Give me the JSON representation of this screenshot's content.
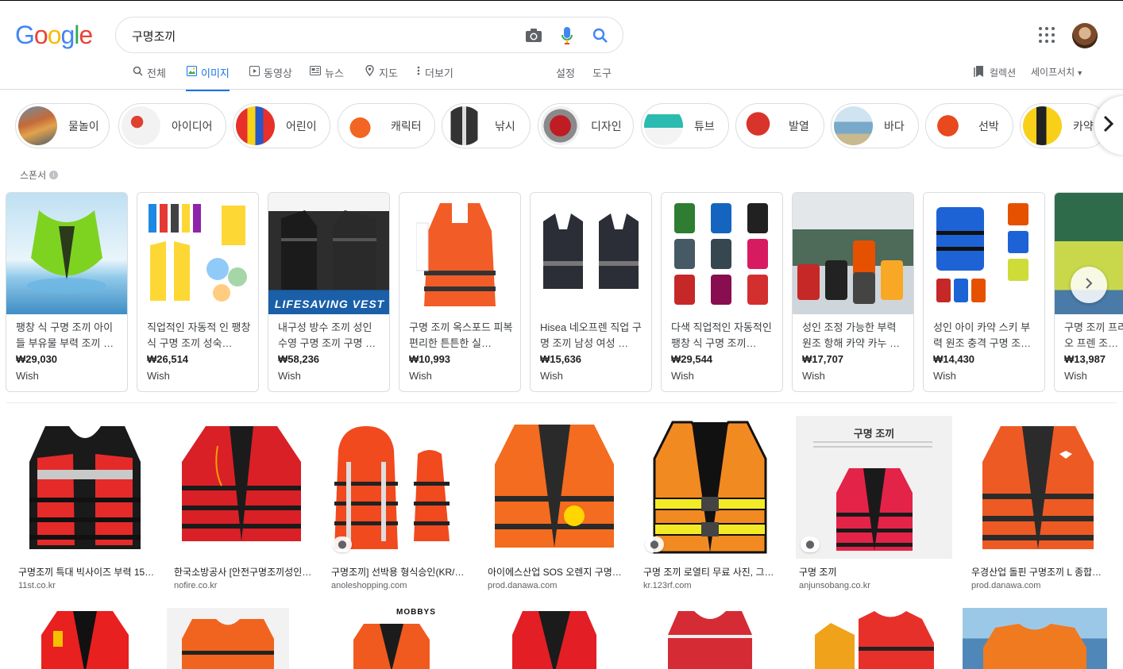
{
  "header": {
    "logo": "Google",
    "query": "구명조끼"
  },
  "tabs": [
    {
      "label": "전체",
      "icon": "search-icon"
    },
    {
      "label": "이미지",
      "icon": "image-icon",
      "active": true
    },
    {
      "label": "동영상",
      "icon": "video-icon"
    },
    {
      "label": "뉴스",
      "icon": "news-icon"
    },
    {
      "label": "지도",
      "icon": "map-pin-icon"
    },
    {
      "label": "더보기",
      "icon": "more-vert-icon"
    }
  ],
  "tools": {
    "settings": "설정",
    "tools": "도구",
    "collections": "컬렉션",
    "safesearch": "세이프서치"
  },
  "chips": [
    "물놀이",
    "아이디어",
    "어린이",
    "캐릭터",
    "낚시",
    "디자인",
    "튜브",
    "발열",
    "바다",
    "선박",
    "카약"
  ],
  "sponsored_label": "스폰서",
  "ads": [
    {
      "title": "팽창 식 구명 조끼 아이들 부유물 부력 조끼 …",
      "price": "₩29,030",
      "store": "Wish"
    },
    {
      "title": "직업적인 자동적 인 팽창 식 구명 조끼 성숙…",
      "price": "₩26,514",
      "store": "Wish"
    },
    {
      "title": "내구성 방수 조끼 성인 수영 구명 조끼 구명 …",
      "price": "₩58,236",
      "store": "Wish"
    },
    {
      "title": "구명 조끼 옥스포드 피복 편리한 튼튼한 실…",
      "price": "₩10,993",
      "store": "Wish"
    },
    {
      "title": "Hisea 네오프렌 직업 구명 조끼 남성 여성 …",
      "price": "₩15,636",
      "store": "Wish"
    },
    {
      "title": "다색 직업적인 자동적인 팽창 식 구명 조끼…",
      "price": "₩29,544",
      "store": "Wish"
    },
    {
      "title": "성인 조정 가능한 부력 원조 항해 카약 카누 …",
      "price": "₩17,707",
      "store": "Wish"
    },
    {
      "title": "성인 아이 카약 스키 부력 원조 충격 구명 조…",
      "price": "₩14,430",
      "store": "Wish"
    },
    {
      "title": "구명 조끼 프리오 프렌 조끼 …",
      "price": "₩13,987",
      "store": "Wish"
    }
  ],
  "results": [
    {
      "title": "구명조끼 특대 빅사이즈 부력 15…",
      "domain": "11st.co.kr"
    },
    {
      "title": "한국소방공사 [안전구명조끼성인…",
      "domain": "nofire.co.kr"
    },
    {
      "title": "구명조끼] 선박용 형식승인(KR/K…",
      "domain": "anoleshopping.com"
    },
    {
      "title": "아이에스산업 SOS 오렌지 구명조…",
      "domain": "prod.danawa.com"
    },
    {
      "title": "구명 조끼 로열티 무료 사진, 그림,…",
      "domain": "kr.123rf.com"
    },
    {
      "title": "구명 조끼",
      "domain": "anjunsobang.co.kr"
    },
    {
      "title": "우경산업 돌핀 구명조끼 L 종합정…",
      "domain": "prod.danawa.com"
    }
  ],
  "image_text": {
    "lifesaving": "LIFESAVING VEST",
    "mobbys": "MOBBYS",
    "product_sign": "구명 조끼"
  },
  "colors": {
    "blue": "#4285F4",
    "red": "#EA4335",
    "yellow": "#FBBC05",
    "green": "#34A853",
    "accent": "#1a73e8"
  }
}
